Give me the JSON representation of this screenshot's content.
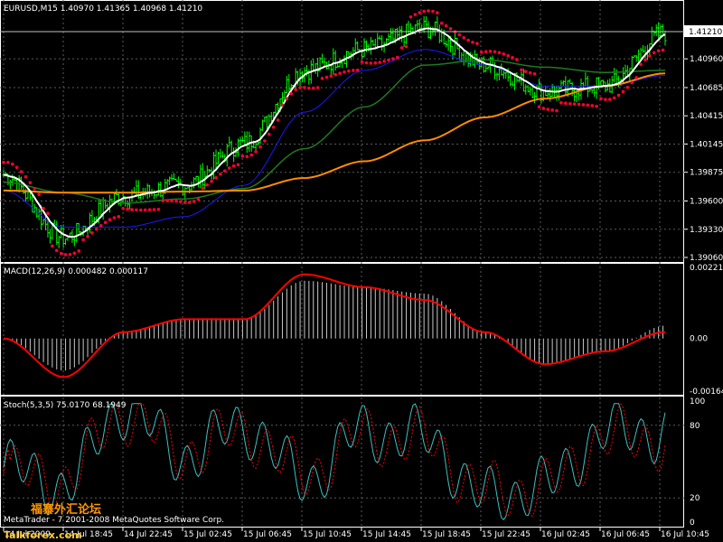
{
  "colors": {
    "background": "#000000",
    "grid": "#5a5a5a",
    "bull_bar": "#00ff00",
    "price_axis_text": "#ffffff",
    "ma_white": "#ffffff",
    "ma_blue": "#1a1aff",
    "ma_green": "#1e7a1e",
    "ma_orange": "#ff8c00",
    "psar": "#ff0033",
    "macd_hist": "#c8c8c8",
    "macd_signal": "#ff0000",
    "stoch_main": "#40c0c0",
    "stoch_signal": "#ff0000",
    "current_price_box": "#ffffff"
  },
  "main_panel": {
    "header": "EURUSD,M15  1.40970 1.41365 1.40968 1.41210",
    "current_price_label": "1.41210",
    "price_ticks": [
      "1.40960",
      "1.40685",
      "1.40415",
      "1.40145",
      "1.39875",
      "1.39600",
      "1.39330",
      "1.39060"
    ]
  },
  "macd_panel": {
    "header": "MACD(12,26,9) 0.000482 0.000117",
    "ticks": [
      "0.002216",
      "0.00",
      "-0.00164"
    ]
  },
  "stoch_panel": {
    "header": "Stoch(5,3,5) 75.0170 68.1949",
    "ticks": [
      "100",
      "80",
      "20",
      "0"
    ]
  },
  "time_axis": {
    "labels": [
      "14 Jul 2009",
      "14 Jul 18:45",
      "14 Jul 22:45",
      "15 Jul 02:45",
      "15 Jul 06:45",
      "15 Jul 10:45",
      "15 Jul 14:45",
      "15 Jul 18:45",
      "15 Jul 22:45",
      "16 Jul 02:45",
      "16 Jul 06:45",
      "16 Jul 10:45"
    ]
  },
  "watermark": {
    "text": "MetaTrader - 7 2001-2008 MetaQuotes Software Corp.",
    "brand_cn": "福寨外汇论坛",
    "brand_en": "Talkforex.com"
  },
  "chart_data": [
    {
      "type": "line",
      "title": "EURUSD,M15  1.40970 1.41365 1.40968 1.41210",
      "ylim": [
        1.3906,
        1.4135
      ],
      "x": [
        "14 Jul 2009",
        "14 Jul 18:45",
        "14 Jul 22:45",
        "15 Jul 02:45",
        "15 Jul 06:45",
        "15 Jul 10:45",
        "15 Jul 14:45",
        "15 Jul 18:45",
        "15 Jul 22:45",
        "16 Jul 02:45",
        "16 Jul 06:45",
        "16 Jul 10:45"
      ],
      "series": [
        {
          "values": [
            1.3985,
            1.3925,
            1.3965,
            1.3975,
            1.4015,
            1.4085,
            1.4105,
            1.4125,
            1.409,
            1.4065,
            1.407,
            1.4121
          ]
        },
        {
          "values": [
            1.397,
            1.3935,
            1.3935,
            1.3945,
            1.3975,
            1.4045,
            1.4085,
            1.4105,
            1.409,
            1.407,
            1.407,
            1.408
          ]
        },
        {
          "values": [
            1.3978,
            1.3968,
            1.3958,
            1.3962,
            1.3972,
            1.401,
            1.405,
            1.409,
            1.4095,
            1.4088,
            1.4083,
            1.4085
          ]
        },
        {
          "values": [
            1.397,
            1.3968,
            1.3968,
            1.3969,
            1.397,
            1.3982,
            1.3998,
            1.4018,
            1.404,
            1.4058,
            1.407,
            1.4082
          ]
        }
      ]
    },
    {
      "type": "bar",
      "title": "MACD(12,26,9) 0.000482 0.000117",
      "ylim": [
        -0.00164,
        0.002216
      ],
      "categories": [
        "14 Jul 2009",
        "14 Jul 18:45",
        "14 Jul 22:45",
        "15 Jul 02:45",
        "15 Jul 06:45",
        "15 Jul 10:45",
        "15 Jul 14:45",
        "15 Jul 18:45",
        "15 Jul 22:45",
        "16 Jul 02:45",
        "16 Jul 06:45",
        "16 Jul 10:45"
      ],
      "series": [
        {
          "values": [
            0.0,
            -0.001,
            0.0002,
            0.0006,
            0.0006,
            0.0018,
            0.0016,
            0.0014,
            0.0002,
            -0.0008,
            -0.0004,
            0.0004
          ]
        },
        {
          "values": [
            0.0,
            -0.0012,
            0.0002,
            0.0006,
            0.0006,
            0.002,
            0.0016,
            0.0012,
            0.0002,
            -0.0008,
            -0.0004,
            0.0002
          ]
        }
      ]
    },
    {
      "type": "line",
      "title": "Stoch(5,3,5) 75.0170 68.1949",
      "ylim": [
        0,
        100
      ],
      "x": [
        "14 Jul 2009",
        "14 Jul 18:45",
        "14 Jul 22:45",
        "15 Jul 02:45",
        "15 Jul 06:45",
        "15 Jul 10:45",
        "15 Jul 14:45",
        "15 Jul 18:45",
        "15 Jul 22:45",
        "16 Jul 02:45",
        "16 Jul 06:45",
        "16 Jul 10:45"
      ],
      "series": [
        {
          "values": [
            45,
            30,
            95,
            55,
            80,
            35,
            75,
            70,
            20,
            30,
            75,
            75
          ]
        },
        {
          "values": [
            40,
            35,
            90,
            58,
            75,
            40,
            72,
            68,
            25,
            28,
            70,
            68
          ]
        }
      ]
    }
  ]
}
